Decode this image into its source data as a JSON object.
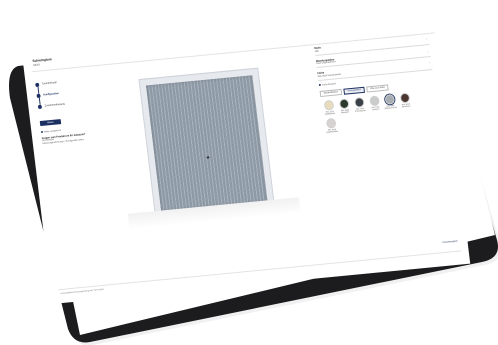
{
  "app": {
    "brand": "Schwingtore",
    "subtitle": "N80/D"
  },
  "steps": [
    {
      "label": "Torantriebsstil"
    },
    {
      "label": "Konfiguration"
    },
    {
      "label": "Zusammenfassung"
    }
  ],
  "cta": {
    "label": "Weiter"
  },
  "info": {
    "line1": "Aktion vergleichen",
    "line2": "Fragen zum Produkt im Ihr Zuhause?",
    "line3": "Jetzt beraten",
    "line4": "Erfahrungsbericht lesen / Konfiguration teilen"
  },
  "rightPanel": {
    "field1": {
      "label": "Motiv",
      "value": "N80"
    },
    "field2": {
      "label": "Wandungslabor",
      "value": "Nach Originalrahmen"
    },
    "field3": {
      "label": "Farbe",
      "value": "RAL 9016 Verkehrsweiss"
    },
    "option": "Farbe Auswahl",
    "tabs": [
      "Standardfarben",
      "Vorzugsfarben",
      "RAL nach Wahl"
    ],
    "swatches": [
      {
        "name": "RAL 1015 Hellelfenbein",
        "color": "#e8dcbc"
      },
      {
        "name": "RAL 6005 Moosgrün",
        "color": "#2b3b2b"
      },
      {
        "name": "RAL 7016 Anthrazitgrau",
        "color": "#3b4148"
      },
      {
        "name": "RAL 7035 Lichtgrau",
        "color": "#c9ccca"
      },
      {
        "name": "RAL 9006 Weißaluminium",
        "color": "#a8adb1"
      },
      {
        "name": "RAL 8028 Terrabraun",
        "color": "#4b3630"
      },
      {
        "name": "RAL 9016 Verkehrsweiss",
        "color": "#d6d2cf"
      }
    ]
  },
  "footer": {
    "link": "Produktvergleich",
    "note": "Unverbindliche Preisempfehlung inkl. 19 % MwSt."
  },
  "colors": {
    "accent": "#1b2f62",
    "tabletBody": "#1c1c1e",
    "doorPanel": "#8e9aa6"
  }
}
